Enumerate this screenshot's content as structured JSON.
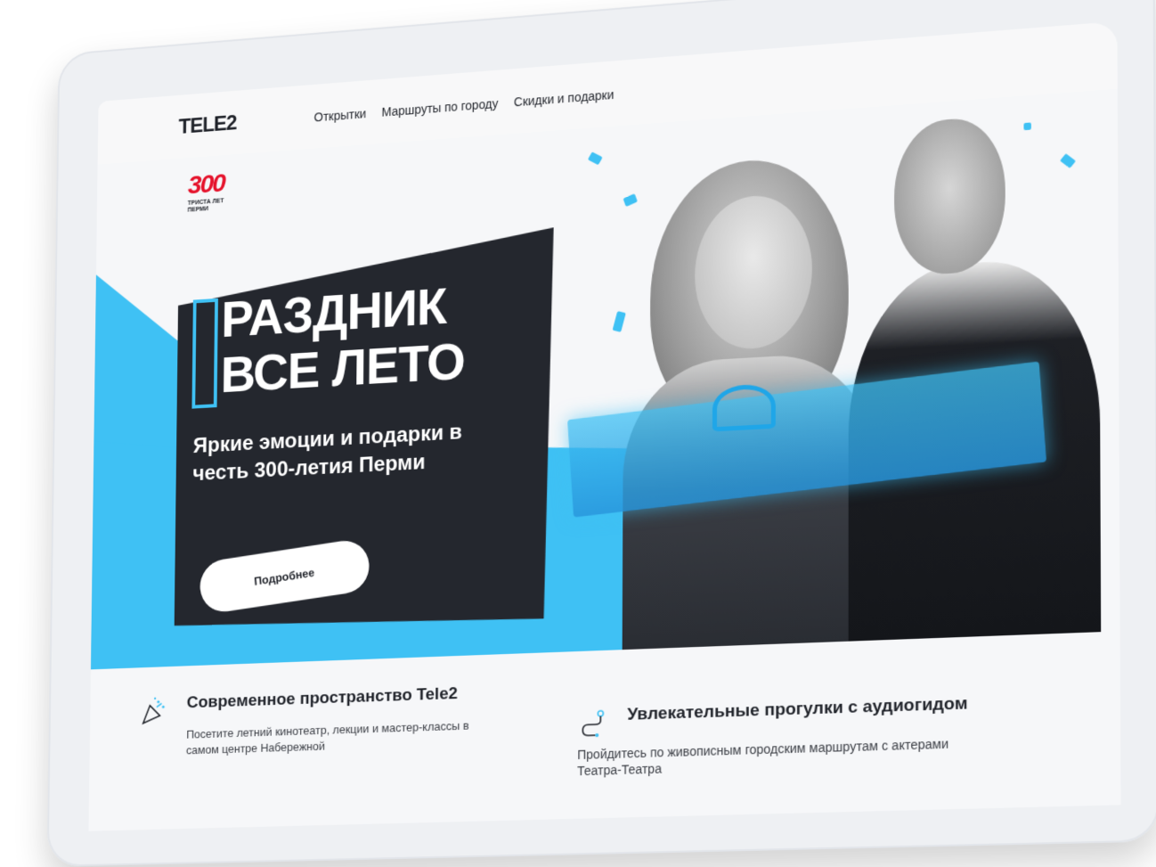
{
  "header": {
    "logo": "TELE2",
    "nav": [
      {
        "label": "Открытки"
      },
      {
        "label": "Маршруты по городу"
      },
      {
        "label": "Скидки и подарки"
      }
    ]
  },
  "badge": {
    "number": "300",
    "line1": "ТРИСТА ЛЕТ",
    "line2": "ПЕРМИ"
  },
  "hero": {
    "title_line1": "РАЗДНИК",
    "title_line2": "ВСЕ ЛЕТО",
    "subtitle": "Яркие эмоции и подарки в честь 300-летия Перми",
    "cta_label": "Подробнее"
  },
  "features": [
    {
      "title": "Современное пространство Tele2",
      "description": "Посетите летний кинотеатр, лекции и мастер-классы в самом центре Набережной",
      "icon": "party-popper-icon"
    },
    {
      "title": "Увлекательные прогулки с аудиогидом",
      "description": "Пройдитесь по живописным городским маршрутам с актерами Театра-Театра",
      "icon": "route-icon"
    }
  ],
  "colors": {
    "accent_blue": "#3fc1f4",
    "dark": "#24272e",
    "brand_red": "#e5122b"
  }
}
